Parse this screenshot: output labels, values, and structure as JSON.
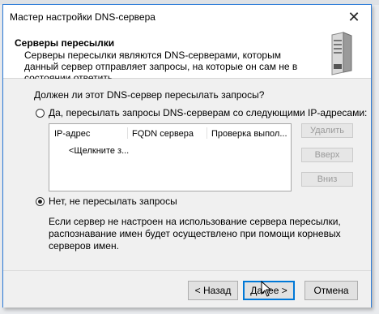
{
  "window": {
    "title": "Мастер настройки DNS-сервера",
    "close_glyph": "✕"
  },
  "header": {
    "title": "Серверы пересылки",
    "description": "Серверы пересылки являются DNS-серверами, которым данный сервер отправляет запросы, на которые он сам не в состоянии ответить.",
    "icon": "server-icon"
  },
  "main": {
    "question": "Должен ли этот DNS-сервер пересылать запросы?",
    "option_forward": {
      "label": "Да, пересылать запросы DNS-серверам со следующими IP-адресами:",
      "selected": false
    },
    "list": {
      "columns": [
        "IP-адрес",
        "FQDN сервера",
        "Проверка выпол..."
      ],
      "placeholder_row": "<Щелкните з..."
    },
    "side_buttons": {
      "delete": "Удалить",
      "up": "Вверх",
      "down": "Вниз"
    },
    "option_no_forward": {
      "label": "Нет, не пересылать запросы",
      "selected": true
    },
    "info": "Если сервер не настроен на использование сервера пересылки, распознавание имен будет осуществлено при помощи корневых серверов имен."
  },
  "footer": {
    "back": "< Назад",
    "next": "Далее >",
    "cancel": "Отмена"
  },
  "colors": {
    "accent": "#0078d7",
    "window_border": "#2b7bd8",
    "panel_bg": "#f0f0f0"
  }
}
